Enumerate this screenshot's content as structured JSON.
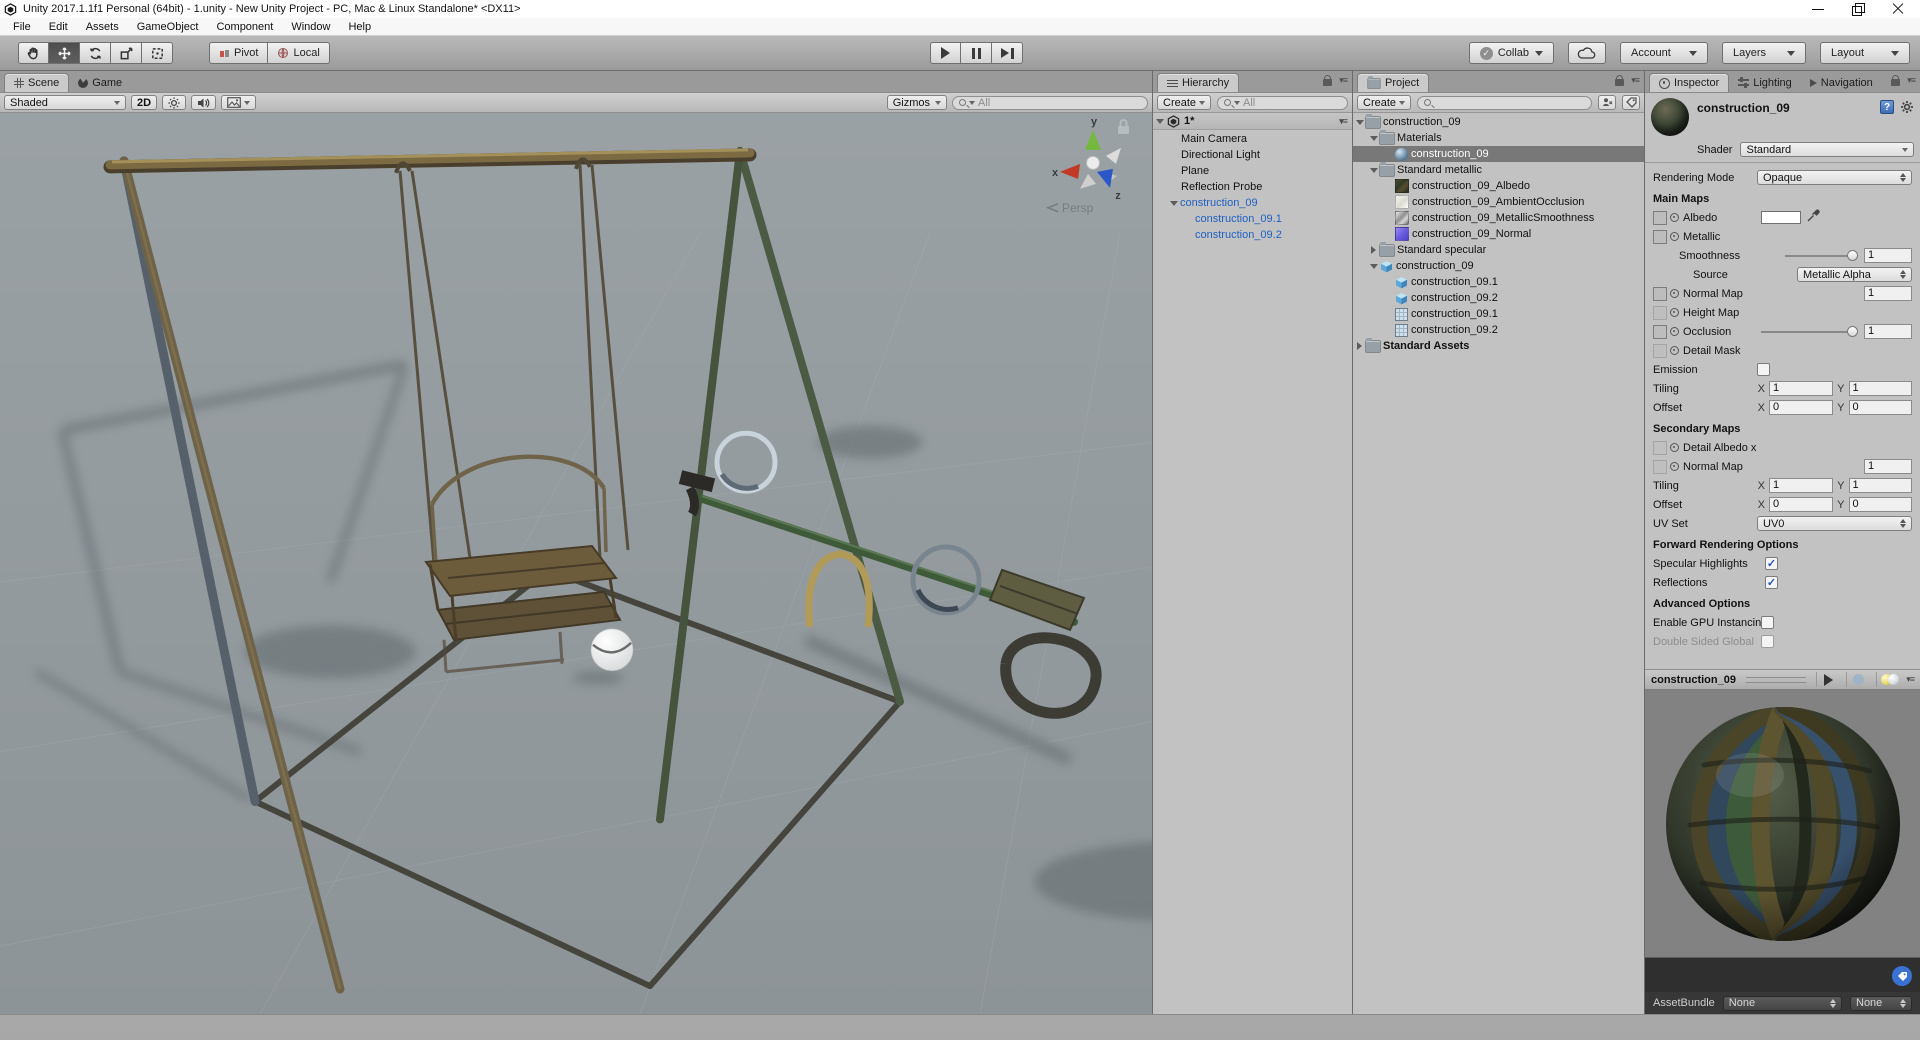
{
  "window": {
    "title": "Unity 2017.1.1f1 Personal (64bit) - 1.unity - New Unity Project - PC, Mac & Linux Standalone* <DX11>"
  },
  "menus": [
    "File",
    "Edit",
    "Assets",
    "GameObject",
    "Component",
    "Window",
    "Help"
  ],
  "toolbar": {
    "pivot": "Pivot",
    "local": "Local",
    "collab": "Collab",
    "account": "Account",
    "layers": "Layers",
    "layout": "Layout"
  },
  "scene_view": {
    "tabs": {
      "scene": "Scene",
      "game": "Game"
    },
    "shading_mode": "Shaded",
    "toggle_2d": "2D",
    "gizmos": "Gizmos",
    "search_placeholder": "All",
    "persp_label": "Persp",
    "axis": {
      "x": "x",
      "y": "y",
      "z": "z"
    }
  },
  "hierarchy": {
    "tab": "Hierarchy",
    "create": "Create",
    "search_placeholder": "All",
    "scene_name": "1*",
    "items": [
      {
        "label": "Main Camera"
      },
      {
        "label": "Directional Light"
      },
      {
        "label": "Plane"
      },
      {
        "label": "Reflection Probe"
      },
      {
        "label": "construction_09"
      },
      {
        "label": "construction_09.1"
      },
      {
        "label": "construction_09.2"
      }
    ]
  },
  "project": {
    "tab": "Project",
    "create": "Create",
    "rows": [
      {
        "label": "construction_09"
      },
      {
        "label": "Materials"
      },
      {
        "label": "construction_09"
      },
      {
        "label": "Standard metallic"
      },
      {
        "label": "construction_09_Albedo"
      },
      {
        "label": "construction_09_AmbientOcclusion"
      },
      {
        "label": "construction_09_MetallicSmoothness"
      },
      {
        "label": "construction_09_Normal"
      },
      {
        "label": "Standard specular"
      },
      {
        "label": "construction_09"
      },
      {
        "label": "construction_09.1"
      },
      {
        "label": "construction_09.2"
      },
      {
        "label": "construction_09.1"
      },
      {
        "label": "construction_09.2"
      },
      {
        "label": "Standard Assets"
      }
    ]
  },
  "inspector": {
    "tabs": {
      "inspector": "Inspector",
      "lighting": "Lighting",
      "navigation": "Navigation"
    },
    "material_name": "construction_09",
    "shader_label": "Shader",
    "shader_value": "Standard",
    "rendering_mode_label": "Rendering Mode",
    "rendering_mode_value": "Opaque",
    "main_maps_heading": "Main Maps",
    "albedo_label": "Albedo",
    "metallic_label": "Metallic",
    "smoothness_label": "Smoothness",
    "smoothness_value": "1",
    "source_label": "Source",
    "source_value": "Metallic Alpha",
    "normal_map_label": "Normal Map",
    "normal_map_value": "1",
    "height_map_label": "Height Map",
    "occlusion_label": "Occlusion",
    "occlusion_value": "1",
    "detail_mask_label": "Detail Mask",
    "emission_label": "Emission",
    "tiling_label": "Tiling",
    "offset_label": "Offset",
    "tiling_x": "1",
    "tiling_y": "1",
    "offset_x": "0",
    "offset_y": "0",
    "axis_x": "X",
    "axis_y": "Y",
    "secondary_maps_heading": "Secondary Maps",
    "detail_albedo_label": "Detail Albedo x",
    "sec_normal_map_label": "Normal Map",
    "sec_normal_map_value": "1",
    "sec_tiling_x": "1",
    "sec_tiling_y": "1",
    "sec_offset_x": "0",
    "sec_offset_y": "0",
    "uv_set_label": "UV Set",
    "uv_set_value": "UV0",
    "forward_heading": "Forward Rendering Options",
    "specular_highlights_label": "Specular Highlights",
    "reflections_label": "Reflections",
    "advanced_heading": "Advanced Options",
    "gpu_instancing_label": "Enable GPU Instancing",
    "double_sided_label": "Double Sided Global",
    "check_glyph": "✓"
  },
  "preview": {
    "title": "construction_09",
    "assetbundle_label": "AssetBundle",
    "bundle_value": "None",
    "variant_value": "None"
  }
}
